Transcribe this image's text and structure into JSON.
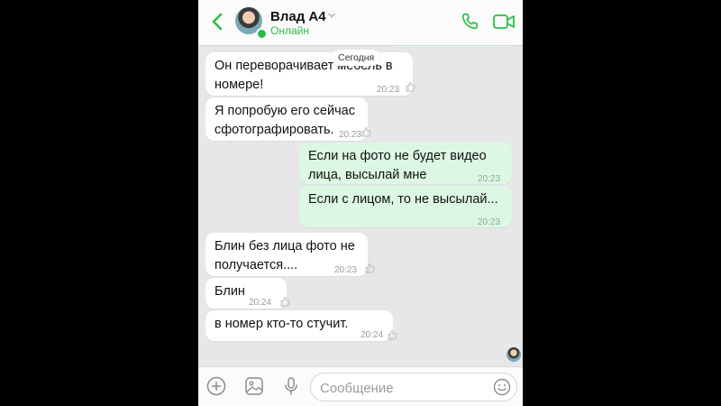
{
  "header": {
    "contact_name": "Влад А4",
    "status": "Онлайн",
    "icons": [
      "back-icon",
      "chevron-down-icon",
      "phone-icon",
      "video-camera-icon"
    ]
  },
  "chat": {
    "date_label": "Сегодня",
    "messages": [
      {
        "direction": "in",
        "lines": [
          "Он переворачивает мебель в",
          "номере!"
        ],
        "time": "20:23"
      },
      {
        "direction": "in",
        "lines": [
          "Я попробую его сейчас",
          "сфотографировать."
        ],
        "time": "20:23"
      },
      {
        "direction": "out",
        "lines": [
          "Если на фото не будет видео",
          "лица, высылай мне"
        ],
        "time": "20:23"
      },
      {
        "direction": "out",
        "lines": [
          "Если с лицом, то не высылай..."
        ],
        "time": "20:23"
      },
      {
        "direction": "in",
        "lines": [
          "Блин без лица фото не",
          "получается...."
        ],
        "time": "20:23"
      },
      {
        "direction": "in",
        "lines": [
          "Блин"
        ],
        "time": "20:24"
      },
      {
        "direction": "in",
        "lines": [
          "в номер кто-то стучит."
        ],
        "time": "20:24"
      }
    ]
  },
  "input": {
    "placeholder": "Сообщение",
    "icons": [
      "plus-icon",
      "image-icon",
      "microphone-icon",
      "emoji-icon"
    ]
  },
  "colors": {
    "accent": "#2dbb4a",
    "outgoing_bubble": "#dcf8e3",
    "incoming_bubble": "#ffffff",
    "background": "#e7e7ea"
  }
}
